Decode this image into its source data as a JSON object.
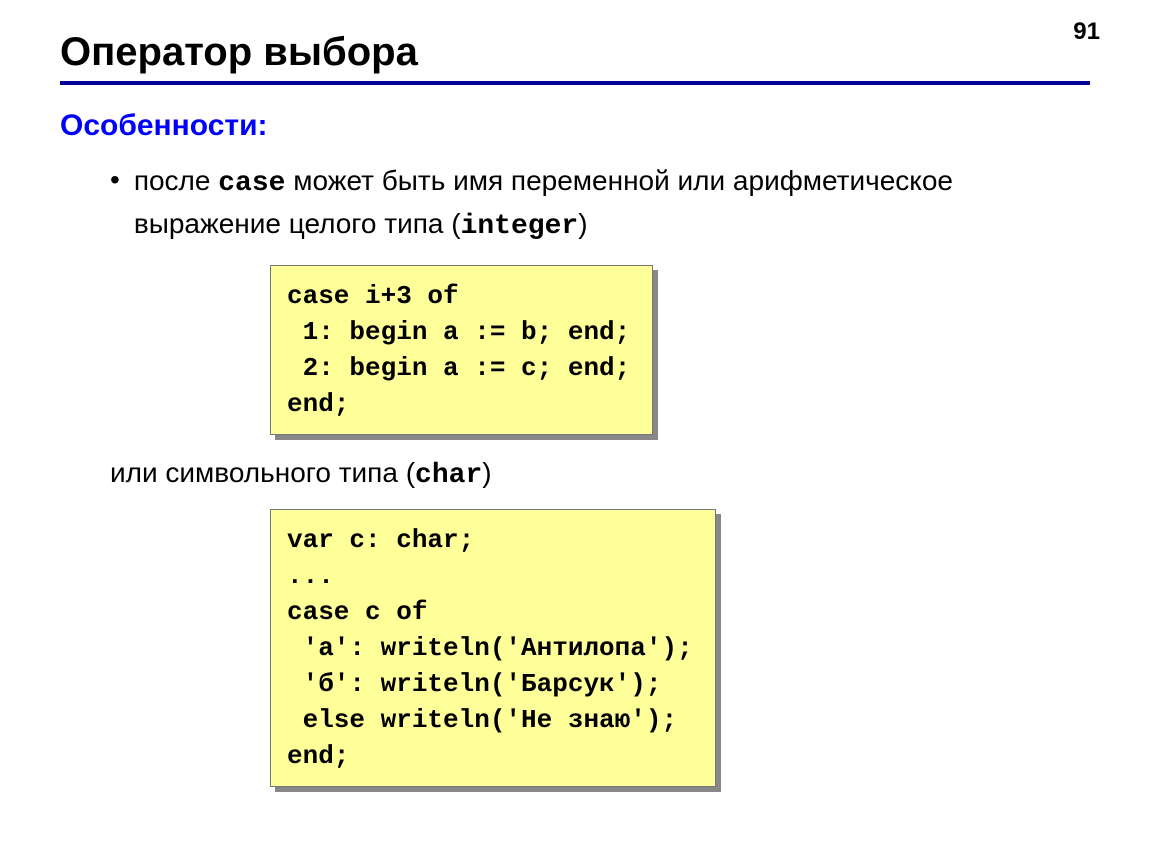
{
  "page_number": "91",
  "title": "Оператор выбора",
  "section_label": "Особенности:",
  "bullet1": {
    "pre": "после ",
    "kw": "case",
    "mid": " может быть имя переменной или арифметическое выражение целого типа (",
    "kw2": "integer",
    "post": ")"
  },
  "code1": "case i+3 of\n 1: begin a := b; end;\n 2: begin a := c; end;\nend;",
  "mid_text": {
    "pre": "или символьного типа (",
    "kw": "char",
    "post": ")"
  },
  "code2": "var c: char;\n...\ncase c of\n 'а': writeln('Антилопа');\n 'б': writeln('Барсук');\n else writeln('Не знаю');\nend;"
}
